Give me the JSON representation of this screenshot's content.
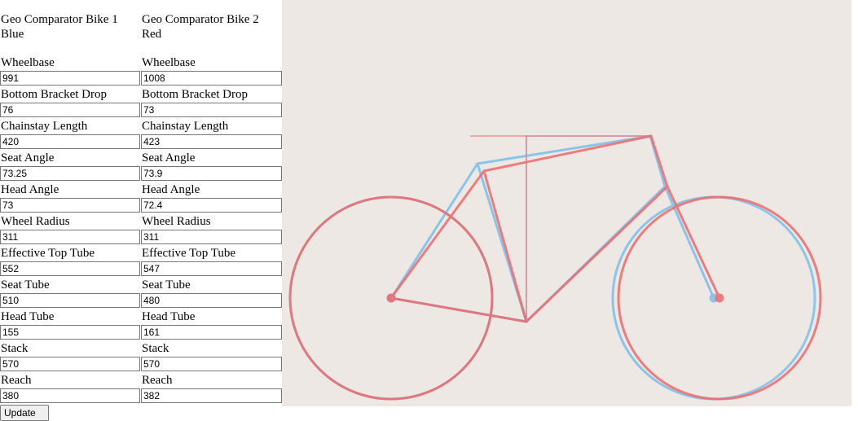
{
  "bike1": {
    "title": "Geo Comparator Bike 1\nBlue",
    "fields": [
      {
        "label": "Wheelbase",
        "value": "991"
      },
      {
        "label": "Bottom Bracket Drop",
        "value": "76"
      },
      {
        "label": "Chainstay Length",
        "value": "420"
      },
      {
        "label": "Seat Angle",
        "value": "73.25"
      },
      {
        "label": "Head Angle",
        "value": "73"
      },
      {
        "label": "Wheel Radius",
        "value": "311"
      },
      {
        "label": "Effective Top Tube",
        "value": "552"
      },
      {
        "label": "Seat Tube",
        "value": "510"
      },
      {
        "label": "Head Tube",
        "value": "155"
      },
      {
        "label": "Stack",
        "value": "570"
      },
      {
        "label": "Reach",
        "value": "380"
      }
    ]
  },
  "bike2": {
    "title": "Geo Comparator Bike 2\nRed",
    "fields": [
      {
        "label": "Wheelbase",
        "value": "1008"
      },
      {
        "label": "Bottom Bracket Drop",
        "value": "73"
      },
      {
        "label": "Chainstay Length",
        "value": "423"
      },
      {
        "label": "Seat Angle",
        "value": "73.9"
      },
      {
        "label": "Head Angle",
        "value": "72.4"
      },
      {
        "label": "Wheel Radius",
        "value": "311"
      },
      {
        "label": "Effective Top Tube",
        "value": "547"
      },
      {
        "label": "Seat Tube",
        "value": "480"
      },
      {
        "label": "Head Tube",
        "value": "161"
      },
      {
        "label": "Stack",
        "value": "570"
      },
      {
        "label": "Reach",
        "value": "382"
      }
    ]
  },
  "update_label": "Update",
  "colors": {
    "bike1": "#7fc2ec",
    "bike2": "#ef6a6a",
    "canvas_bg": "#ede8e4"
  }
}
